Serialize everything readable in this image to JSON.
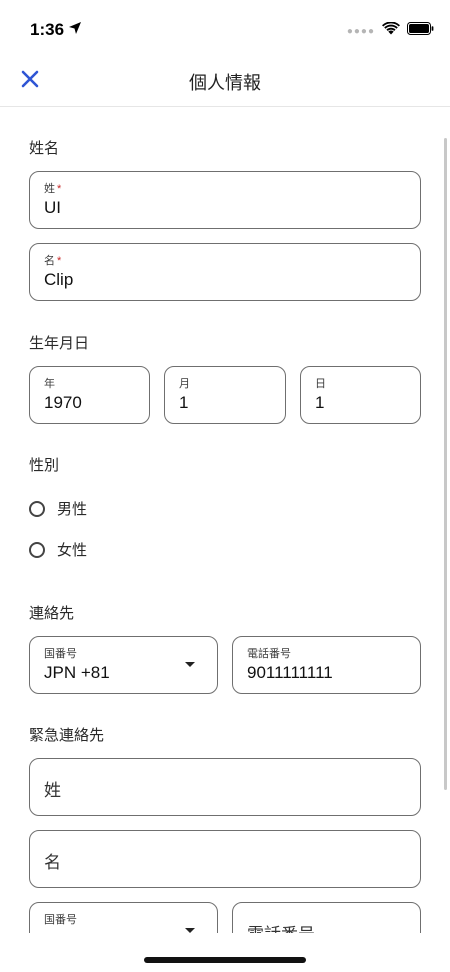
{
  "status": {
    "time": "1:36"
  },
  "nav": {
    "title": "個人情報",
    "close_icon": "close-x",
    "accent": "#2f55d4"
  },
  "name_section": {
    "title": "姓名",
    "last_name": {
      "label": "姓",
      "required": "*",
      "value": "UI"
    },
    "first_name": {
      "label": "名",
      "required": "*",
      "value": "Clip"
    }
  },
  "birthdate_section": {
    "title": "生年月日",
    "year": {
      "label": "年",
      "value": "1970"
    },
    "month": {
      "label": "月",
      "value": "1"
    },
    "day": {
      "label": "日",
      "value": "1"
    }
  },
  "gender_section": {
    "title": "性別",
    "options": [
      {
        "label": "男性",
        "selected": false
      },
      {
        "label": "女性",
        "selected": false
      }
    ]
  },
  "contact_section": {
    "title": "連絡先",
    "country_code": {
      "label": "国番号",
      "value": "JPN +81"
    },
    "phone": {
      "label": "電話番号",
      "value": "9011111111"
    }
  },
  "emergency_section": {
    "title": "緊急連絡先",
    "last_name_placeholder": "姓",
    "first_name_placeholder": "名",
    "country_code_label": "国番号",
    "phone_placeholder": "電話番号"
  }
}
